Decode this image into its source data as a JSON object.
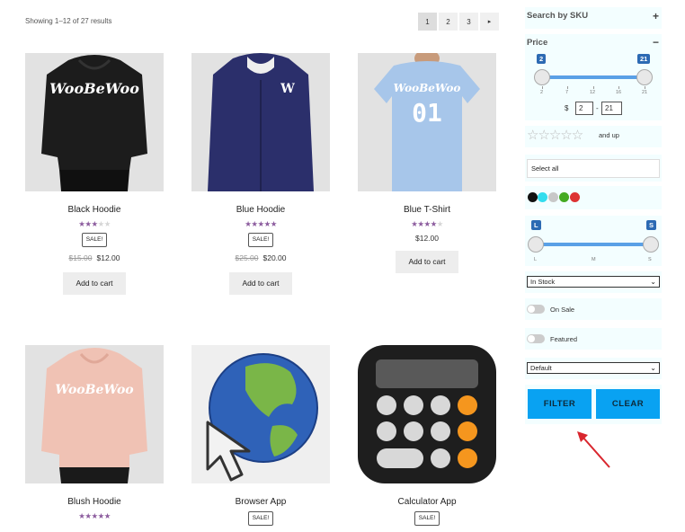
{
  "toolbar": {
    "results_count": "Showing 1–12 of 27 results",
    "pages": [
      "1",
      "2",
      "3"
    ],
    "next_label": "▸"
  },
  "products": [
    {
      "name": "Black Hoodie",
      "rating": 3,
      "sale": "SALE!",
      "old_price": "$15.00",
      "price": "$12.00",
      "button": "Add to cart",
      "logo": "WooBeWoo"
    },
    {
      "name": "Blue Hoodie",
      "rating": 5,
      "sale": "SALE!",
      "old_price": "$25.00",
      "price": "$20.00",
      "button": "Add to cart",
      "logo": "W"
    },
    {
      "name": "Blue T-Shirt",
      "rating": 4,
      "price": "$12.00",
      "button": "Add to cart",
      "logo": "WooBeWoo",
      "number": "01"
    },
    {
      "name": "Blush Hoodie",
      "rating": 5,
      "logo": "WooBeWoo"
    },
    {
      "name": "Browser App",
      "sale": "SALE!"
    },
    {
      "name": "Calculator App",
      "sale": "SALE!"
    }
  ],
  "sidebar": {
    "sku_title": "Search by SKU",
    "sku_toggle": "+",
    "price_title": "Price",
    "price_toggle": "−",
    "price_min": 2,
    "price_max": 21,
    "price_min_label": "2",
    "price_max_label": "21",
    "price_scale": [
      "2",
      "7",
      "12",
      "16",
      "21"
    ],
    "currency": "$",
    "price_from": "2",
    "price_to": "21",
    "price_sep": "-",
    "rating_suffix": "and up",
    "category_select": "Select all",
    "colors": [
      "#111111",
      "#33ddee",
      "#c8c8c8",
      "#44aa22",
      "#dd3333"
    ],
    "size_min_label": "L",
    "size_max_label": "S",
    "size_scale": [
      "L",
      "M",
      "S"
    ],
    "stock_select": "In Stock",
    "on_sale_label": "On Sale",
    "featured_label": "Featured",
    "sort_select": "Default",
    "filter_button": "FILTER",
    "clear_button": "CLEAR"
  },
  "colors": {
    "accent": "#09a2f2",
    "star": "#8c5c9e",
    "panel_bg": "#f3feff",
    "range_fill": "#5aa0e6",
    "arrow": "#d9262e"
  }
}
